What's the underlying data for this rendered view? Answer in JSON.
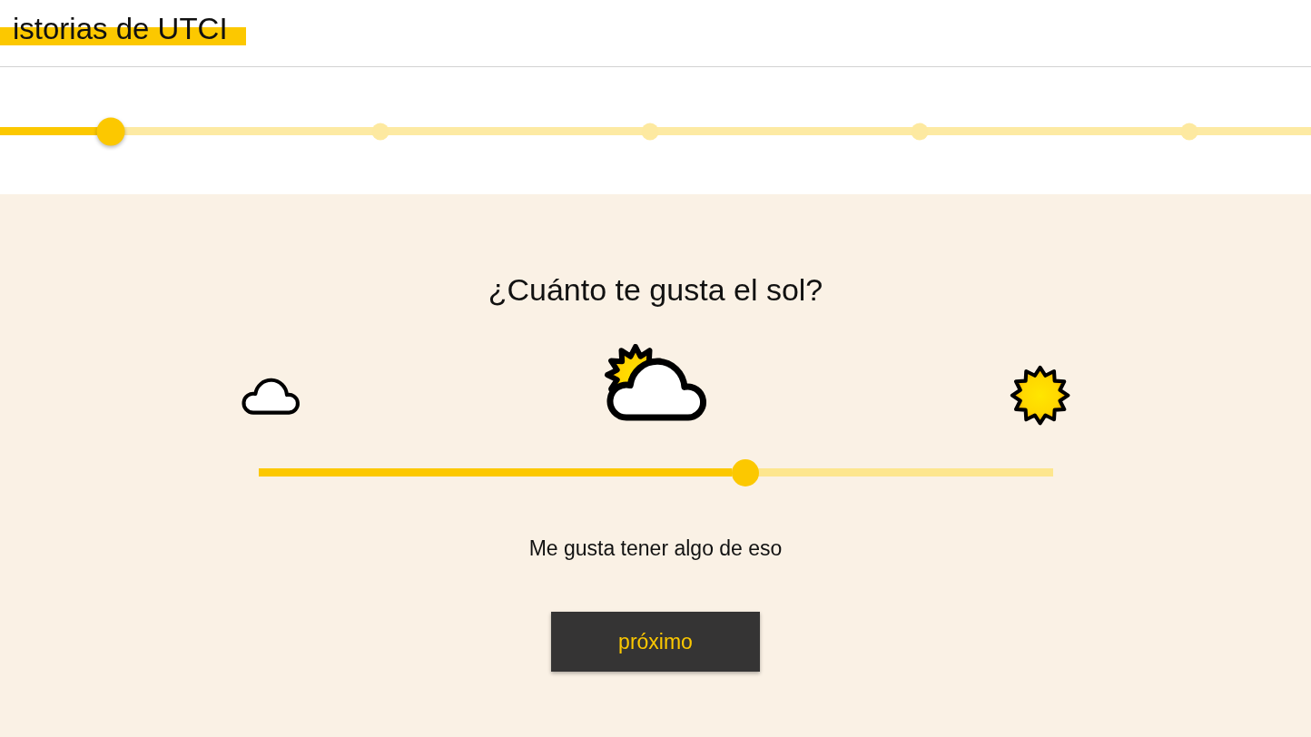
{
  "header": {
    "title": "istorias de UTCI"
  },
  "progress": {
    "level": 0.085,
    "steps": [
      {
        "current": true
      },
      {
        "current": false
      },
      {
        "current": false
      },
      {
        "current": false
      },
      {
        "current": false
      }
    ]
  },
  "question": {
    "title": "¿Cuánto te gusta el sol?",
    "scale_icons": [
      {
        "kind": "cloud",
        "selected": false
      },
      {
        "kind": "sun_behind_cloud",
        "selected": true
      },
      {
        "kind": "sun",
        "selected": false
      }
    ],
    "slider": {
      "level": 0.613
    },
    "answer": "Me gusta tener algo de eso",
    "next_button": "próximo"
  }
}
